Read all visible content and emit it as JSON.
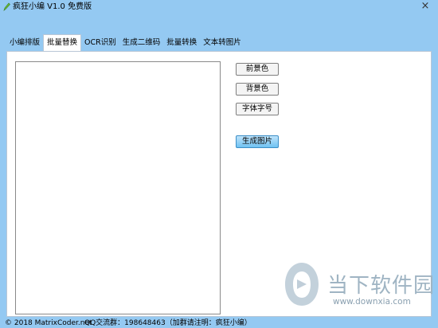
{
  "window": {
    "title": "疯狂小编 V1.0 免费版",
    "close": "×"
  },
  "tabs": [
    {
      "label": "小编排版",
      "active": false
    },
    {
      "label": "批量替换",
      "active": true
    },
    {
      "label": "OCR识别",
      "active": false
    },
    {
      "label": "生成二维码",
      "active": false
    },
    {
      "label": "批量转换",
      "active": false
    },
    {
      "label": "文本转图片",
      "active": false
    }
  ],
  "editor": {
    "value": ""
  },
  "buttons": {
    "foreground": "前景色",
    "background": "背景色",
    "font": "字体字号",
    "generate": "生成图片"
  },
  "watermark": {
    "text": "当下软件园",
    "url": "www.downxia.com"
  },
  "status": {
    "copyright": "© 2018 MatrixCoder.net",
    "qq": "QQ交流群：198648463（加群请注明：疯狂小编）"
  },
  "colors": {
    "window_bg": "#94c9f2",
    "accent_button": "#6fc2f2"
  }
}
